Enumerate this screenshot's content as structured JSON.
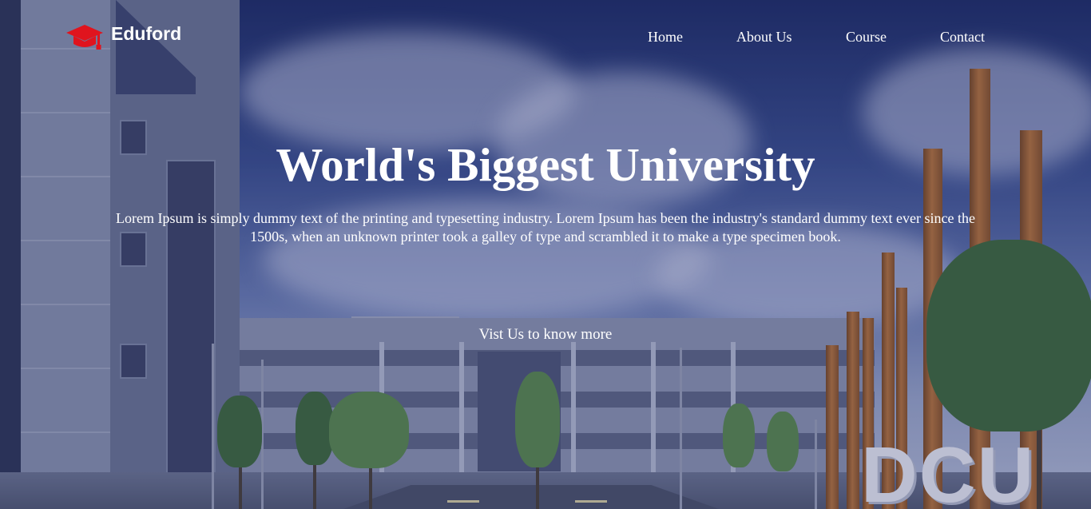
{
  "brand": {
    "name": "Eduford",
    "icon": "graduation-cap-icon",
    "icon_color": "#e0141e"
  },
  "nav": {
    "items": [
      "Home",
      "About Us",
      "Course",
      "Contact"
    ]
  },
  "hero": {
    "title": "World's Biggest University",
    "description": "Lorem Ipsum is simply dummy text of the printing and typesetting industry. Lorem Ipsum has been the industry's standard dummy text ever since the 1500s, when an unknown printer took a galley of type and scrambled it to make a type specimen book.",
    "cta": "Vist Us to know more"
  },
  "background": {
    "sign_text": "DCU",
    "overlay_color": "#1c2460"
  }
}
